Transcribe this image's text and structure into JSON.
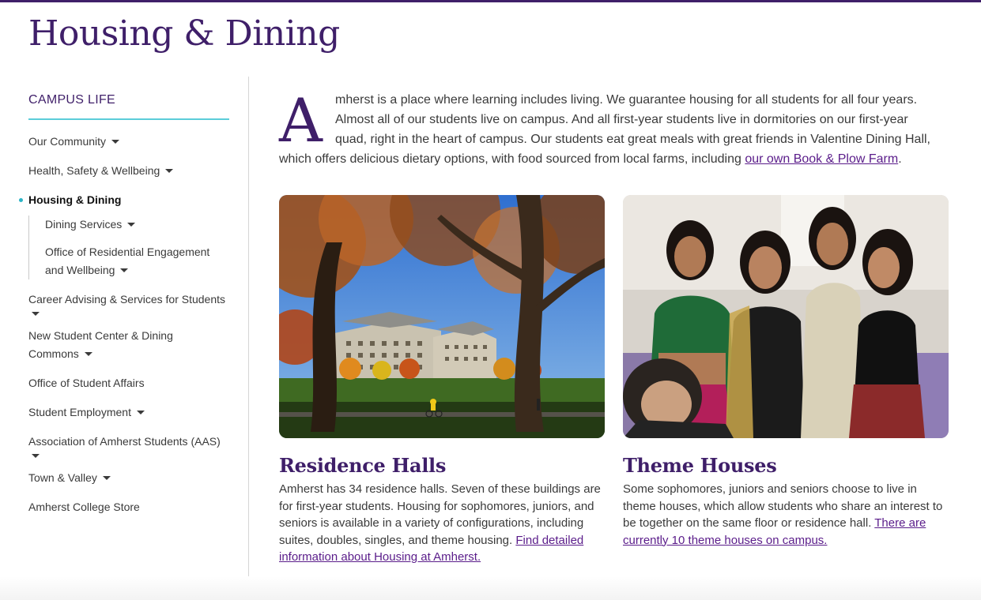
{
  "page": {
    "title": "Housing & Dining",
    "brand_color": "#3f1f69",
    "accent_color": "#5bcdd9"
  },
  "sidebar": {
    "heading": "CAMPUS LIFE",
    "items": [
      {
        "label": "Our Community",
        "has_dropdown": true
      },
      {
        "label": "Health, Safety & Wellbeing",
        "has_dropdown": true
      },
      {
        "label": "Housing & Dining",
        "active": true
      },
      {
        "label": "Career Advising & Services for Students",
        "has_dropdown": true
      },
      {
        "label": "New Student Center & Dining Commons",
        "has_dropdown": true
      },
      {
        "label": "Office of Student Affairs"
      },
      {
        "label": "Student Employment",
        "has_dropdown": true
      },
      {
        "label": "Association of Amherst Students (AAS)",
        "has_dropdown": true
      },
      {
        "label": "Town & Valley",
        "has_dropdown": true
      },
      {
        "label": "Amherst College Store"
      }
    ],
    "subitems": [
      {
        "label": "Dining Services",
        "has_dropdown": true
      },
      {
        "label": "Office of Residential Engagement and Wellbeing",
        "has_dropdown": true
      }
    ]
  },
  "intro": {
    "dropcap": "A",
    "text": "mherst is a place where learning includes living. We guarantee housing for all students for all four years. Almost all of our students live on campus. And all first-year students live in dormitories on our first-year quad, right in the heart of campus. Our students eat great meals with great friends in Valentine Dining Hall, which offers delicious dietary options, with food sourced from local farms, including ",
    "link": "our own Book & Plow Farm",
    "end": "."
  },
  "cards": [
    {
      "image": "residence-hall-photo",
      "title": "Residence Halls",
      "text": "Amherst has 34 residence halls. Seven of these buildings are for first-year students. Housing for sophomores, juniors, and seniors is available in a variety of configurations, including suites, doubles, singles, and theme housing. ",
      "link": "Find detailed information about Housing at Amherst."
    },
    {
      "image": "theme-house-students-photo",
      "title": "Theme Houses",
      "text": "Some sophomores, juniors and seniors choose to live in theme houses, which allow students who share an interest to be together on the same floor or residence hall. ",
      "link": "There are currently 10 theme houses on campus."
    }
  ]
}
